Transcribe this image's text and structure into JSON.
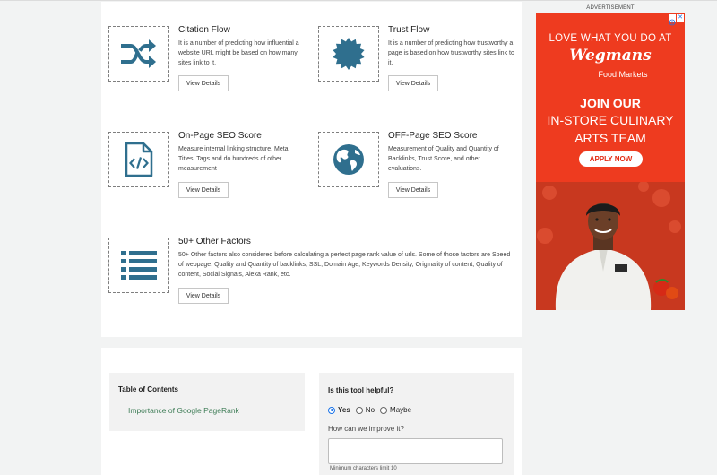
{
  "features": [
    {
      "title": "Citation Flow",
      "description": "It is a number of predicting how influential a website URL might be based on how many sites link to it.",
      "button": "View Details",
      "icon": "shuffle-icon"
    },
    {
      "title": "Trust Flow",
      "description": "It is a number of predicting how trustworthy a page is based on how trustworthy sites link to it.",
      "button": "View Details",
      "icon": "badge-icon"
    },
    {
      "title": "On-Page SEO Score",
      "description": "Measure internal linking structure, Meta Titles, Tags and do hundreds of other measurement",
      "button": "View Details",
      "icon": "code-file-icon"
    },
    {
      "title": "OFF-Page SEO Score",
      "description": "Measurement of Quality and Quantity of Backlinks, Trust Score, and other evaluations.",
      "button": "View Details",
      "icon": "globe-icon"
    },
    {
      "title": "50+ Other Factors",
      "description": "50+ Other factors also considered before calculating a perfect page rank value of urls. Some of those factors are Speed of webpage, Quality and Quantity of backlinks, SSL, Domain Age, Keywords Density, Originality of content, Quality of content, Social Signals, Alexa Rank, etc.",
      "button": "View Details",
      "icon": "list-icon"
    }
  ],
  "toc": {
    "title": "Table of Contents",
    "links": [
      "Importance of Google PageRank"
    ]
  },
  "feedback": {
    "title": "Is this tool helpful?",
    "options": [
      "Yes",
      "No",
      "Maybe"
    ],
    "selected": "Yes",
    "improve_label": "How can we improve it?",
    "improve_value": "",
    "min_chars": "Minimum characters limit 10"
  },
  "ad": {
    "label": "ADVERTISEMENT",
    "line1": "LOVE WHAT YOU DO AT",
    "brand": "Wegmans",
    "brand_sub": "Food Markets",
    "headline": "JOIN OUR",
    "subline": "IN-STORE CULINARY ARTS TEAM",
    "cta": "APPLY NOW",
    "background": "#ee3b1f"
  },
  "colors": {
    "icon": "#2f6f8e",
    "link": "#3f7d57",
    "radio_selected": "#1a73e8"
  }
}
